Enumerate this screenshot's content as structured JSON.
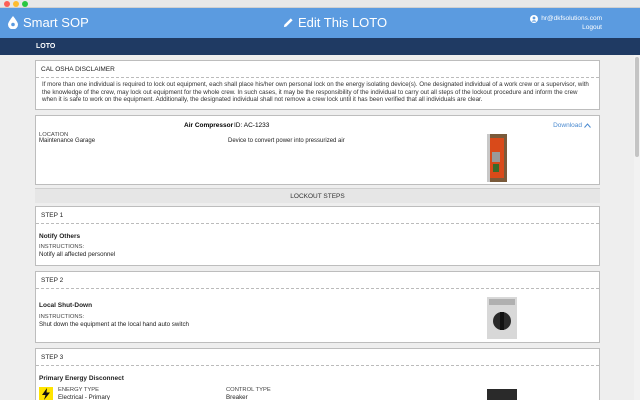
{
  "window": {
    "controls": [
      "close",
      "minimize",
      "zoom"
    ]
  },
  "header": {
    "brand": "Smart SOP",
    "page_title": "Edit This LOTO",
    "user_email": "hr@dkfsolutions.com",
    "logout": "Logout",
    "background_color": "#5b9be0"
  },
  "subbar": {
    "label": "LOTO",
    "background_color": "#1f3a63"
  },
  "disclaimer": {
    "title": "CAL OSHA DISCLAIMER",
    "text": "If more than one individual is required to lock out equipment, each shall place his/her own personal lock on the energy isolating device(s). One designated individual of a work crew or a supervisor, with the knowledge of the crew, may lock out equipment for the whole crew. In such cases, it may be the responsibility of the individual to carry out all steps of the lockout procedure and inform the crew when it is safe to work on the equipment. Additionally, the designated individual shall not remove a crew lock until it has been verified that all individuals are clear."
  },
  "asset": {
    "name": "Air Compressor",
    "id": "ID: AC-1233",
    "download": "Download",
    "location_label": "LOCATION",
    "location": "Maintenance Garage",
    "description": "Device to convert power into pressurized air"
  },
  "lockout_title": "LOCKOUT STEPS",
  "steps": [
    {
      "header": "STEP 1",
      "title": "Notify Others",
      "instructions_label": "INSTRUCTIONS:",
      "instructions": "Notify all affected personnel"
    },
    {
      "header": "STEP 2",
      "title": "Local Shut-Down",
      "instructions_label": "INSTRUCTIONS:",
      "instructions": "Shut down the equipment at the local hand auto switch"
    },
    {
      "header": "STEP 3",
      "title": "Primary Energy Disconnect",
      "energy_type_label": "ENERGY TYPE",
      "energy_type": "Electrical - Primary",
      "control_type_label": "CONTROL TYPE",
      "control_type": "Breaker"
    }
  ],
  "accent_color": "#4a8ad0"
}
